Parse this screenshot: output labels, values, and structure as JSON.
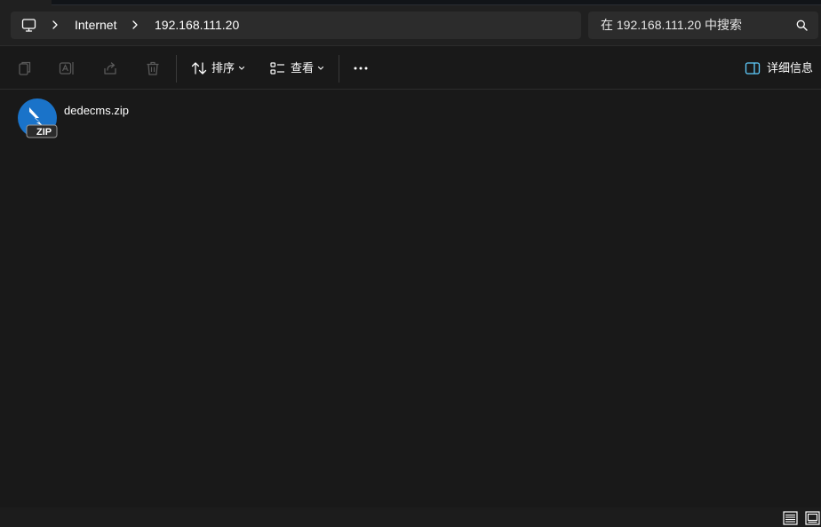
{
  "address_bar": {
    "breadcrumbs": [
      "Internet",
      "192.168.111.20"
    ],
    "root_icon": "computer-icon",
    "separator_icon": "chevron-right-icon"
  },
  "search": {
    "placeholder": "在 192.168.111.20 中搜索",
    "icon": "search-icon"
  },
  "toolbar": {
    "copy_icon": "copy-icon",
    "rename_icon": "rename-icon",
    "share_icon": "share-icon",
    "delete_icon": "delete-icon",
    "sort_label": "排序",
    "view_label": "查看",
    "more_icon": "more-icon",
    "details_label": "详细信息"
  },
  "files": [
    {
      "name": "dedecms.zip",
      "icon": "zip-archive-icon",
      "badge": "ZIP"
    }
  ],
  "statusbar": {
    "view_icons": [
      "details-view-icon",
      "large-icons-view-icon"
    ]
  },
  "colors": {
    "background": "#191919",
    "panel": "#202020",
    "field": "#2c2c2c",
    "accent": "#60cdff",
    "zip_blue": "#1a73c9"
  }
}
